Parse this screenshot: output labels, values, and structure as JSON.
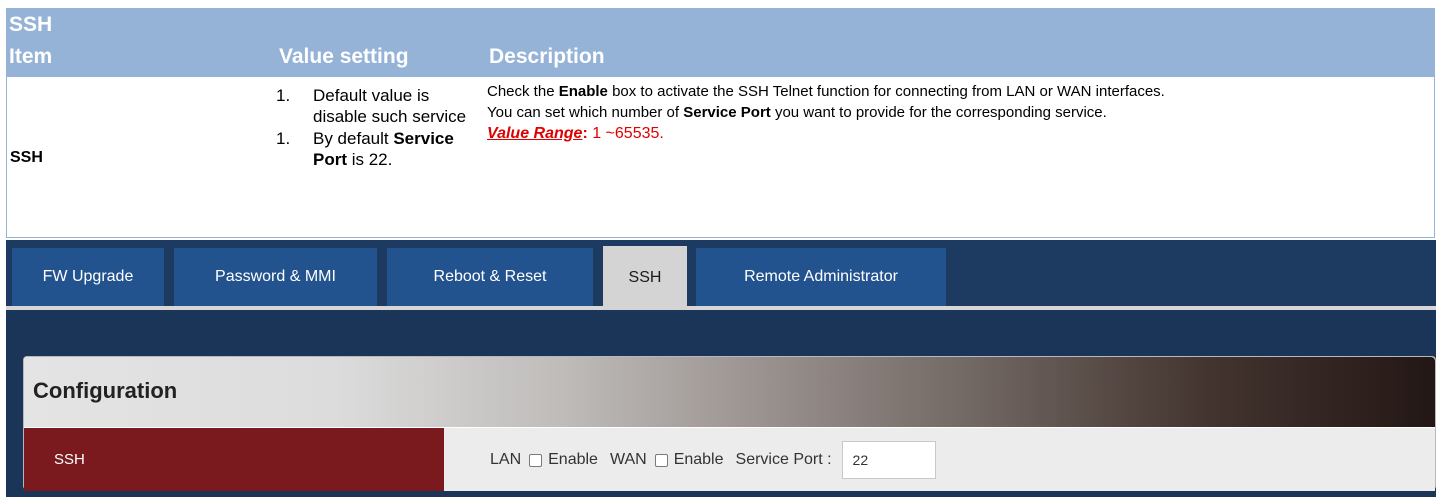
{
  "doc": {
    "title": "SSH",
    "headers": {
      "item": "Item",
      "value": "Value setting",
      "description": "Description"
    },
    "row": {
      "item": "SSH",
      "values": [
        {
          "num": "1.",
          "text_parts": [
            {
              "t": "Default value is disable such service",
              "b": false
            }
          ]
        },
        {
          "num": "1.",
          "text_parts": [
            {
              "t": "By default ",
              "b": false
            },
            {
              "t": "Service Port",
              "b": true
            },
            {
              "t": " is 22.",
              "b": false
            }
          ]
        }
      ],
      "desc_line1_a": "Check the ",
      "desc_line1_b": "Enable",
      "desc_line1_c": " box to activate the SSH Telnet function for connecting from LAN or WAN interfaces.",
      "desc_line2_a": "You can set which number of ",
      "desc_line2_b": "Service Port",
      "desc_line2_c": " you want to provide for the corresponding service.",
      "range_label": "Value Range",
      "range_colon": ":",
      "range_value": " 1 ~65535."
    }
  },
  "ui": {
    "tabs": [
      {
        "label": "FW Upgrade",
        "active": false
      },
      {
        "label": "Password & MMI",
        "active": false
      },
      {
        "label": "Reboot & Reset",
        "active": false
      },
      {
        "label": "SSH",
        "active": true
      },
      {
        "label": "Remote Administrator",
        "active": false
      }
    ],
    "config": {
      "title": "Configuration",
      "row_label": "SSH",
      "lan_label": "LAN",
      "lan_enable_label": "Enable",
      "wan_label": "WAN",
      "wan_enable_label": "Enable",
      "port_label": "Service Port :",
      "port_value": "22"
    }
  }
}
